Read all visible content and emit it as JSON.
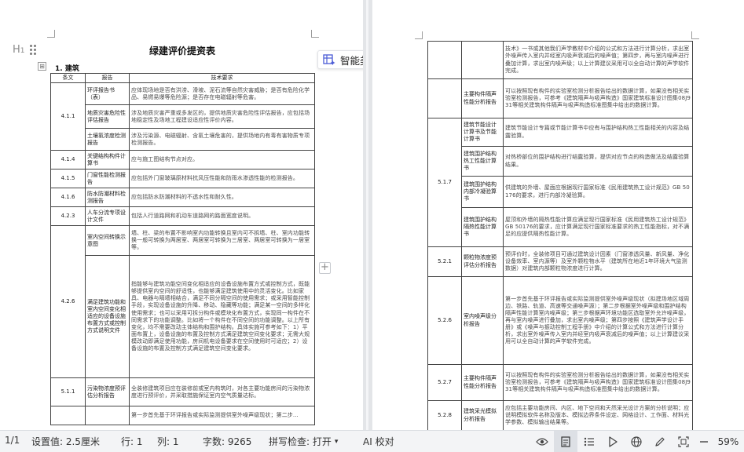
{
  "document": {
    "title": "绿建评价提资表",
    "section": "1. 建筑",
    "paragraph_mark": "H",
    "table_handle": "⊞",
    "add_column": "+"
  },
  "toolbar": {
    "beautify_label": "智能美化表格",
    "beautify_icon": "table-beautify-icon"
  },
  "left_table": {
    "headers": [
      "条文",
      "报告",
      "技术要求"
    ],
    "rows": [
      {
        "clause": "4.1.1",
        "report": "环评报告书（表）",
        "req": "应体现场地是否有洪涝、滑坡、泥石流等自然灾害威胁；是否有危险化学品、易燃易爆等危险源；是否存在电磁辐射等危害。"
      },
      {
        "clause": "",
        "report": "地质灾害危险性评估报告",
        "req": "涉及地质灾害严重或多发区的，提供地质灾害危险性评估报告，应包括场地稳定性及场地工程建设适应性评价内容。"
      },
      {
        "clause": "",
        "report": "土壤氡浓度检测报告",
        "req": "涉及污染源、电磁辐射、含氡土壤危害的，提供场地内有毒有害物质专项检测报告。"
      },
      {
        "clause": "4.1.4",
        "report": "关键结构构件计算书",
        "req": "应与施工图结构节点对应。"
      },
      {
        "clause": "4.1.5",
        "report": "门窗性能检测报告",
        "req": "应包括外门窗玻璃原材料抗风压性能和防雨水渗透性能的检测报告。"
      },
      {
        "clause": "4.1.6",
        "report": "防水防潮材料检测报告",
        "req": "应包括防水防潮材料的不透水性和耐久性。"
      },
      {
        "clause": "4.2.3",
        "report": "人车分流专项设计文件",
        "req": "包括人行道路网和机动车道路网的路面宽度说明。"
      },
      {
        "clause": "4.2.6",
        "report": "室内空间转换示意图",
        "req": "墙、柱、梁的布置不影响室内功能转换且室内可不拆墙、柱、室内功能转换一般可转换为两居室、两居室可转换为三居室、两居室可转换为一居室等。"
      },
      {
        "clause": "",
        "report": "满足建筑功能和室内空间变化相适应的设备设施布置方式或控制方式说明文件",
        "req": "指能够与建筑功能空间变化相适应的设备设施布置方式或控制方式，既能够提供室内空间的舒适性，也能够满足建筑使用中的灵活变化。比如家具、电器与隔墙相结合，满足不同分隔空间的使用需求；或采用智能控制手段，实现设备设施的升降、移动、隐藏等功能；满足某一空间的多样化使用需求；也可以采用可拆分构件或模块化布置方式，实现同一构件在不同需求下的功能调整。比如将一个构件在不同空间的功能调整。以上所有变化，均不需要改动主体结构和围护结构。具体实施可参考如下：1）平面布置上，设备设施的布置及控制方式满足建筑空间变化要求；无需大规模改动即满足使用功能，房间机电设备要求在空间使用时可适应；2）设备设施的布置及控制方式满足建筑空间变化要求。"
      },
      {
        "clause": "5.1.1",
        "report": "污染物浓度预评估分析报告",
        "req": "全装修建筑项目应在装修前或室内构筑时，对各主要功能房间的污染物浓度进行预评价，并采取措施保证室内空气质量达标。"
      },
      {
        "clause": "",
        "report": "",
        "req": "第一步首先基于环评报告或实际监测提供室外噪声级现状；第二步..."
      }
    ]
  },
  "right_table": {
    "rows": [
      {
        "clause": "",
        "report": "",
        "req": "技术》一书或其他我们声学教材中介绍的公式和方法进行计算分析，求出室外噪声传入室内并经室内吸声衰减后的噪声值；第四步，再与室内噪声进行叠加计算，求出室内噪声级；以上计算建议采用可以全自动计算的声学软件完成。"
      },
      {
        "clause": "",
        "report": "主要构件隔声性能分析报告",
        "req": "可以按照现有构件的实验室检测分析报告给出的数据计算，如果没有相关实验室检测报告，可参考《建筑隔声与吸声构造》国家建筑标准设计图集08J931等相关建筑构件隔声与吸声构造标准图集中给出的数据计算。"
      },
      {
        "clause": "5.1.7",
        "report": "建筑节能设计计算书及节能计算书",
        "req": "建筑节能设计专篇或节能计算书中应有与围护结构热工性能相关的内容及结露验算。"
      },
      {
        "clause": "",
        "report": "建筑围护结构热工性能计算书",
        "req": "对热桥部位的围护结构进行结露验算，提供对应节点的构造做法及结露验算结果。"
      },
      {
        "clause": "",
        "report": "建筑围护结构内部冷凝验算书",
        "req": "供建筑的外墙、屋面应根据现行国家标准《民用建筑热工设计规范》GB 50176的要求，进行内部冷凝验算。"
      },
      {
        "clause": "",
        "report": "建筑围护结构隔热性能计算书",
        "req": "屋顶和外墙的隔热性能计算应满足现行国家标准《民用建筑热工设计规范》GB 50176的要求，应计算满足现行国家标准要求的热工性能指标，对不满足的应提供隔热性能计算。"
      },
      {
        "clause": "5.2.1",
        "report": "颗粒物浓度预评估分析报告",
        "req": "预评价时，全装修项目可通过建筑设计因素（门窗渗透风量、新风量、净化设备效率、室内源等）及室外颗粒物水平（建筑所在地近1年环境大气监测数据）对建筑内部颗粒物浓度进行计算。"
      },
      {
        "clause": "5.2.6",
        "report": "室内噪声级分析报告",
        "req": "第一步首先基于环评报告或实际监测提供室外噪声级现状（拟建场地区域周边、铁路、轨道、高速等交通噪声源）；第二步根据室外噪声级和围护结构隔声性能计算室内噪声级；第三步根据声环境功能区选取室外允许噪声级，再与室内噪声进行叠加，求出室内噪声级；第四步按照《建筑声学设计手册》或《噪声与振动控制工程手册》中介绍的计算公式和方法进行计算分析，求出室外噪声传入室内并经室内吸声衰减后的噪声值；以上计算建议采用可以全自动计算的声学软件完成。"
      },
      {
        "clause": "5.2.7",
        "report": "主要构件隔声性能分析报告",
        "req": "可以按照现有构件的实验室检测分析报告给出的数据计算，如果没有相关实验室检测报告，可参考《建筑隔声与吸声构造》国家建筑标准设计图集08J931等相关建筑构件隔声与吸声构造标准图集中给出的数据计算。"
      },
      {
        "clause": "5.2.8",
        "report": "建筑采光模拟分析报告",
        "req": "应包括主要功能房间、内区、地下空间和天然采光设计方案的分析说明；应说明模拟软件名称及版本、模拟边界条件设定、网格设计、工作面、材料光学参数、模拟输出结果等。"
      }
    ]
  },
  "statusbar": {
    "page": "1/1",
    "setting_value": "设置值: 2.5厘米",
    "row": "行: 1",
    "column": "列: 1",
    "word_count": "字数: 9265",
    "spell_check": "拼写检查: 打开",
    "ai_proofread": "AI 校对",
    "zoom": "59%",
    "icons": [
      "eye-icon",
      "page-view-icon",
      "outline-icon",
      "play-icon",
      "web-icon",
      "pen-icon",
      "fit-page-icon",
      "zoom-out-icon"
    ]
  },
  "colors": {
    "workspace": "#e9ebee",
    "statusbar": "#f3f4f6",
    "beautify_accent": "#4a5bd6"
  }
}
